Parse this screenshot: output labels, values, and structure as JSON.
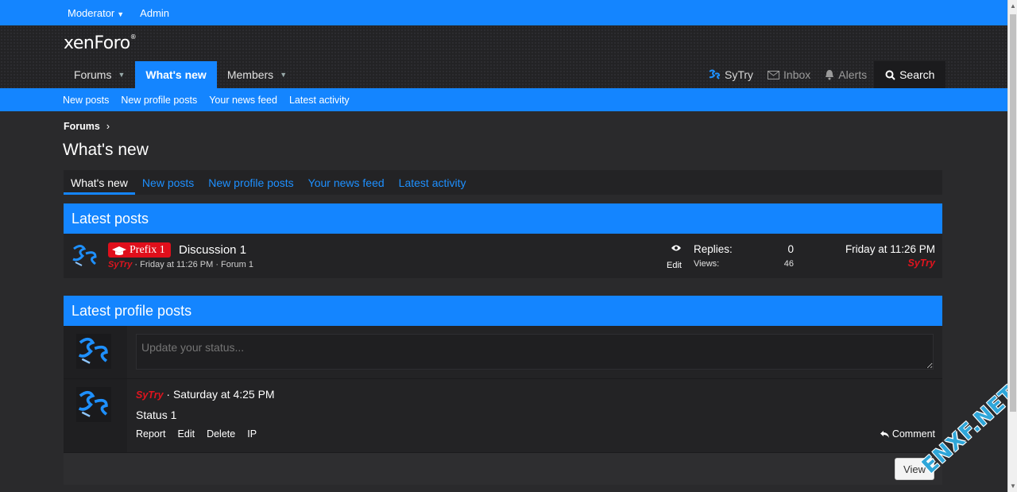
{
  "staff_bar": {
    "moderator": "Moderator",
    "admin": "Admin"
  },
  "header": {
    "logo_xen": "xen",
    "logo_foro": "Foro",
    "tabs": [
      {
        "label": "Forums"
      },
      {
        "label": "What's new"
      },
      {
        "label": "Members"
      }
    ],
    "right": {
      "user": "SyTry",
      "inbox": "Inbox",
      "alerts": "Alerts",
      "search": "Search"
    }
  },
  "sub_nav": [
    "New posts",
    "New profile posts",
    "Your news feed",
    "Latest activity"
  ],
  "breadcrumb": {
    "item": "Forums"
  },
  "page_title": "What's new",
  "tabs": [
    "What's new",
    "New posts",
    "New profile posts",
    "Your news feed",
    "Latest activity"
  ],
  "latest_posts": {
    "heading": "Latest posts",
    "thread": {
      "prefix": "Prefix 1",
      "title": "Discussion 1",
      "author": "SyTry",
      "meta": " · Friday at 11:26 PM · Forum 1",
      "edit": "Edit",
      "replies_label": "Replies:",
      "replies": "0",
      "views_label": "Views:",
      "views": "46",
      "last_date": "Friday at 11:26 PM",
      "last_user": "SyTry"
    }
  },
  "latest_profile_posts": {
    "heading": "Latest profile posts",
    "status_placeholder": "Update your status...",
    "post": {
      "author": "SyTry",
      "time": " · Saturday at 4:25 PM",
      "text": "Status 1",
      "actions": [
        "Report",
        "Edit",
        "Delete",
        "IP"
      ],
      "comment": "Comment"
    },
    "view_button": "View"
  },
  "watermark": "ENXF.NET",
  "colors": {
    "accent": "#1485ff",
    "username": "#e0141e",
    "prefix": "#e00f1b"
  }
}
